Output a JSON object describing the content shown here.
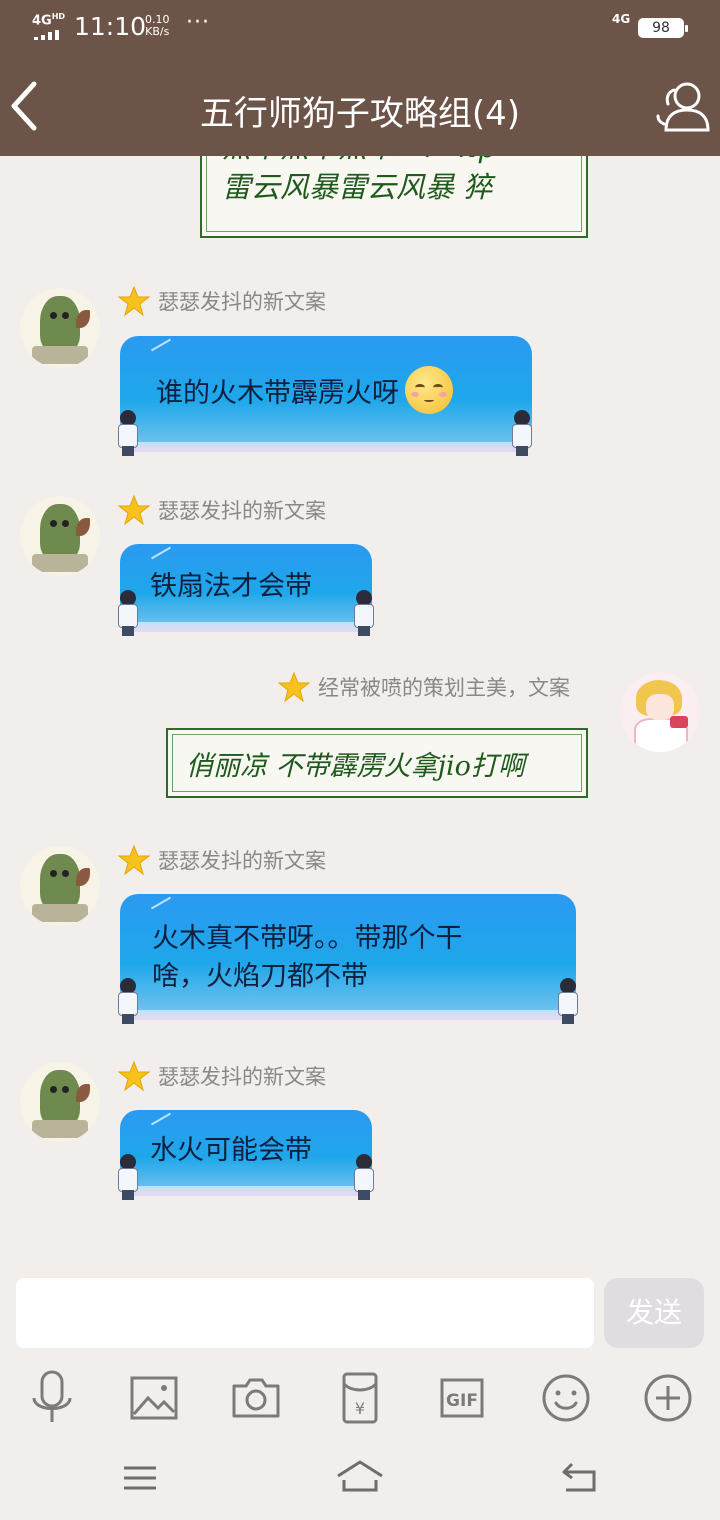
{
  "status_bar": {
    "network_top": "4G",
    "network_hd": "HD",
    "time": "11:10",
    "speed_value": "0.10",
    "speed_unit": "KB/s",
    "dots": "···",
    "network_right": "4G",
    "battery": "98"
  },
  "header": {
    "title": "五行师狗子攻略组(4)"
  },
  "messages": [
    {
      "type": "image",
      "lines": [
        "熬木熬木熬木=？ hp",
        "雷云风暴雷云风暴 猝"
      ]
    },
    {
      "sender": "瑟瑟发抖的新文案",
      "text": "谁的火木带霹雳火呀"
    },
    {
      "sender": "瑟瑟发抖的新文案",
      "text": "铁扇法才会带"
    },
    {
      "sender": "经常被喷的策划主美，文案",
      "text": "俏丽凉 不带霹雳火拿jio打啊"
    },
    {
      "sender": "瑟瑟发抖的新文案",
      "text_line1": "火木真不带呀。。带那个干",
      "text_line2": "啥，火焰刀都不带"
    },
    {
      "sender": "瑟瑟发抖的新文案",
      "text": "水火可能会带"
    }
  ],
  "input": {
    "placeholder": "",
    "value": "",
    "send_label": "发送"
  },
  "toolbar": [
    "mic-icon",
    "image-icon",
    "camera-icon",
    "red-packet-icon",
    "gif-icon",
    "emoji-icon",
    "plus-icon"
  ],
  "toolbar_gif_label": "GIF",
  "toolbar_currency": "¥"
}
